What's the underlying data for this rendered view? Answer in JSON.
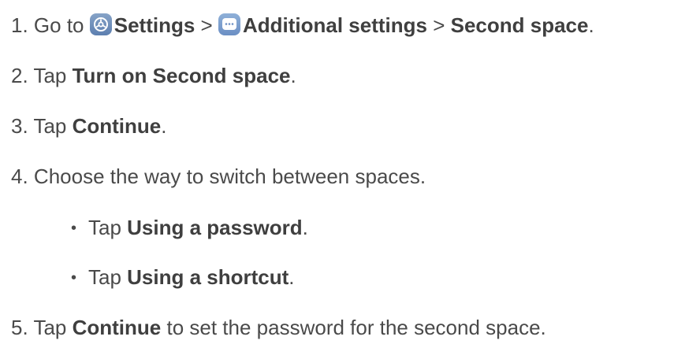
{
  "steps": [
    {
      "number": "1.",
      "parts": {
        "prefix": "Go to ",
        "settings_label": "Settings",
        "separator_1": " > ",
        "additional_label": "Additional settings",
        "separator_2": " > ",
        "second_space_label": "Second space",
        "suffix": "."
      },
      "icons": [
        "settings-icon",
        "additional-settings-icon"
      ]
    },
    {
      "number": "2.",
      "parts": {
        "prefix": "Tap ",
        "bold": "Turn on Second space",
        "suffix": "."
      }
    },
    {
      "number": "3.",
      "parts": {
        "prefix": "Tap ",
        "bold": "Continue",
        "suffix": "."
      }
    },
    {
      "number": "4.",
      "parts": {
        "text": "Choose the way to switch between spaces."
      },
      "sub_items": [
        {
          "bullet": "•",
          "prefix": "Tap ",
          "bold": "Using a password",
          "suffix": "."
        },
        {
          "bullet": "•",
          "prefix": "Tap ",
          "bold": "Using a shortcut",
          "suffix": "."
        }
      ]
    },
    {
      "number": "5.",
      "parts": {
        "prefix": "Tap ",
        "bold": "Continue",
        "suffix": " to set the password for the second space."
      }
    }
  ]
}
